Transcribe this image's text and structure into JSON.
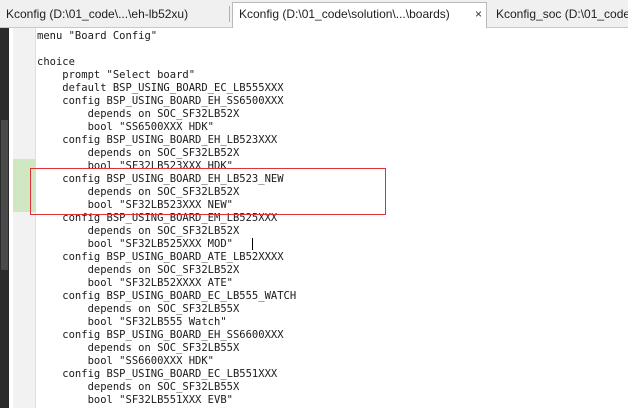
{
  "tabs": [
    {
      "label": "Kconfig (D:\\01_code\\...\\eh-lb52xu)"
    },
    {
      "label": "Kconfig (D:\\01_code\\solution\\...\\boards)",
      "close": "×"
    },
    {
      "label": "Kconfig_soc (D:\\01_code\\..."
    }
  ],
  "code_lines": [
    "menu \"Board Config\"",
    "",
    "choice",
    "    prompt \"Select board\"",
    "    default BSP_USING_BOARD_EC_LB555XXX",
    "    config BSP_USING_BOARD_EH_SS6500XXX",
    "        depends on SOC_SF32LB52X",
    "        bool \"SS6500XXX HDK\"",
    "    config BSP_USING_BOARD_EH_LB523XXX",
    "        depends on SOC_SF32LB52X",
    "        bool \"SF32LB523XXX HDK\"",
    "    config BSP_USING_BOARD_EH_LB523_NEW",
    "        depends on SOC_SF32LB52X",
    "        bool \"SF32LB523XXX NEW\"",
    "    config BSP_USING_BOARD_EM_LB525XXX",
    "        depends on SOC_SF32LB52X",
    "        bool \"SF32LB525XXX MOD\"",
    "    config BSP_USING_BOARD_ATE_LB52XXXX",
    "        depends on SOC_SF32LB52X",
    "        bool \"SF32LB52XXXX ATE\"",
    "    config BSP_USING_BOARD_EC_LB555_WATCH",
    "        depends on SOC_SF32LB55X",
    "        bool \"SF32LB555 Watch\"",
    "    config BSP_USING_BOARD_EH_SS6600XXX",
    "        depends on SOC_SF32LB55X",
    "        bool \"SS6600XXX HDK\"",
    "    config BSP_USING_BOARD_EC_LB551XXX",
    "        depends on SOC_SF32LB55X",
    "        bool \"SF32LB551XXX EVB\""
  ]
}
